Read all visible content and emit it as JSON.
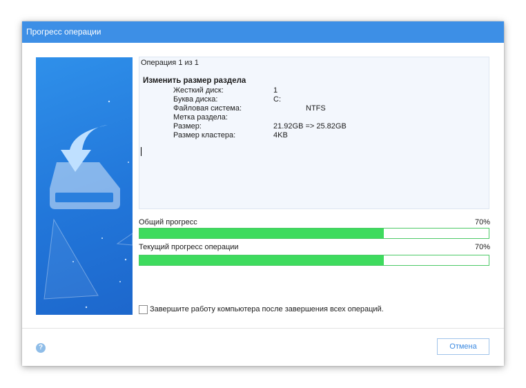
{
  "window": {
    "title": "Прогресс операции"
  },
  "details": {
    "operation_counter": "Операция 1 из 1",
    "operation_title": "Изменить размер раздела",
    "properties": [
      {
        "key": "Жесткий диск:",
        "value": "1"
      },
      {
        "key": "Буква диска:",
        "value": "C:"
      },
      {
        "key": "Файловая система:",
        "value": "NTFS"
      },
      {
        "key": "Метка раздела:",
        "value": ""
      },
      {
        "key": "Размер:",
        "value": "21.92GB => 25.82GB"
      },
      {
        "key": "Размер кластера:",
        "value": "4KB"
      }
    ]
  },
  "progress": {
    "overall": {
      "label": "Общий прогресс",
      "percent_text": "70%",
      "fraction": 0.7
    },
    "current": {
      "label": "Текущий прогресс операции",
      "percent_text": "70%",
      "fraction": 0.7
    }
  },
  "shutdown_option": {
    "label": "Завершите работу компьютера после завершения всех операций.",
    "checked": false
  },
  "footer": {
    "help_icon": "question-mark-icon",
    "cancel_label": "Отмена"
  },
  "colors": {
    "titlebar": "#3d8fe6",
    "progress_fill": "#3edb5e",
    "side_panel": "#2277da",
    "cancel_text": "#3c8ae1"
  }
}
